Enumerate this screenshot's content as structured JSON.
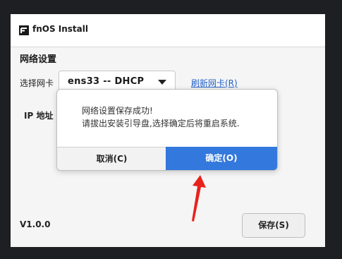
{
  "window": {
    "title": "fnOS Install",
    "app_icon": "fnos-logo-icon"
  },
  "network": {
    "section_title": "网络设置",
    "nic_label": "选择网卡",
    "nic_selected": "ens33 -- DHCP",
    "refresh_link": "刷新网卡(R)",
    "ip_label": "IP 地址"
  },
  "dialog": {
    "line1": "网络设置保存成功!",
    "line2": "请拔出安装引导盘,选择确定后将重启系统.",
    "cancel_label": "取消(C)",
    "ok_label": "确定(O)"
  },
  "footer": {
    "version": "V1.0.0",
    "save_label": "保存(S)"
  },
  "colors": {
    "accent": "#3378dd",
    "link": "#2563c9",
    "annotation_arrow": "#e8221a"
  }
}
